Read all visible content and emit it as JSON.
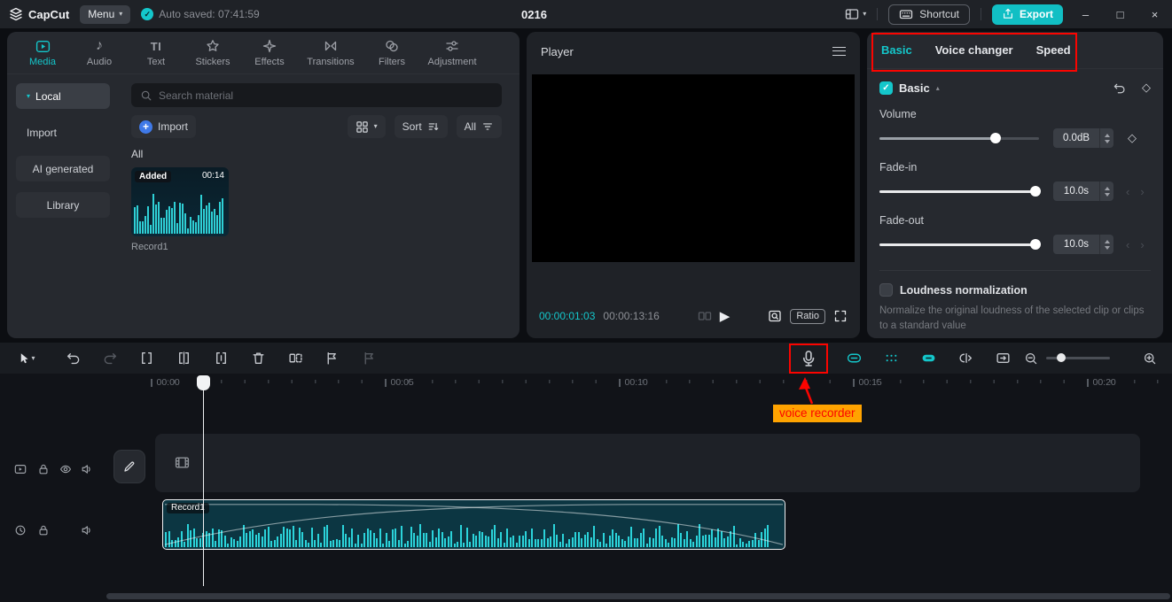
{
  "colors": {
    "accent": "#14c7cb",
    "export_teal": "#11bfc4",
    "annotation_red": "#fb0400",
    "annotation_bg": "#ffa300"
  },
  "titlebar": {
    "logo": "CapCut",
    "menu": "Menu",
    "autosave": "Auto saved: 07:41:59",
    "project_title": "0216",
    "shortcut": "Shortcut",
    "export": "Export"
  },
  "media_panel": {
    "tabs": [
      {
        "label": "Media",
        "active": true
      },
      {
        "label": "Audio"
      },
      {
        "label": "Text"
      },
      {
        "label": "Stickers"
      },
      {
        "label": "Effects"
      },
      {
        "label": "Transitions"
      },
      {
        "label": "Filters"
      },
      {
        "label": "Adjustment"
      }
    ],
    "sidebar": [
      {
        "label": "Local",
        "active": true
      },
      {
        "label": "Import"
      },
      {
        "label": "AI generated"
      },
      {
        "label": "Library"
      }
    ],
    "search_placeholder": "Search material",
    "import_button": "Import",
    "sort_label": "Sort",
    "filter_label": "All",
    "section_label": "All",
    "card": {
      "badge": "Added",
      "duration": "00:14",
      "caption": "Record1"
    }
  },
  "player": {
    "title": "Player",
    "current_time": "00:00:01:03",
    "total_time": "00:00:13:16",
    "ratio": "Ratio"
  },
  "properties": {
    "tabs": [
      {
        "label": "Basic",
        "active": true
      },
      {
        "label": "Voice changer"
      },
      {
        "label": "Speed"
      }
    ],
    "section": "Basic",
    "volume": {
      "label": "Volume",
      "value": "0.0dB",
      "percent": 73
    },
    "fade_in": {
      "label": "Fade-in",
      "value": "10.0s",
      "percent": 98
    },
    "fade_out": {
      "label": "Fade-out",
      "value": "10.0s",
      "percent": 98
    },
    "loudness": {
      "label": "Loudness normalization",
      "description": "Normalize the original loudness of the selected clip or clips to a standard value"
    }
  },
  "timeline": {
    "ruler": [
      "00:00",
      "00:05",
      "00:10",
      "00:15",
      "00:20"
    ],
    "clip_name": "Record1"
  },
  "annotation": {
    "label": "voice recorder"
  },
  "icons": {
    "caret_down": "▾",
    "caret_up": "▴",
    "check": "✓",
    "play": "▶",
    "note": "♪",
    "diamond": "◇",
    "minimize": "–",
    "maximize": "□",
    "close": "×",
    "prev": "‹",
    "next": "›",
    "text_tab": "TI"
  }
}
